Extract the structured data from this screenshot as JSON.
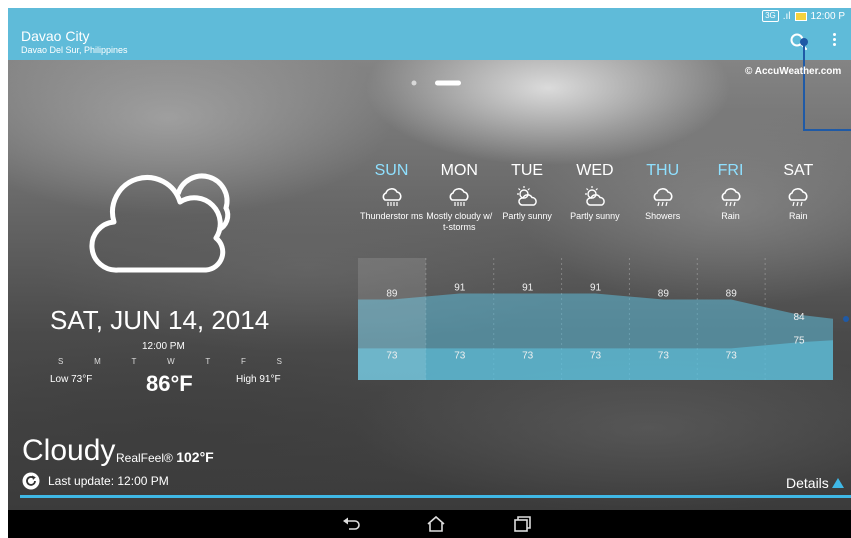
{
  "status_bar": {
    "network": "3G",
    "signal": ".ıl",
    "time": "12:00 P"
  },
  "app_bar": {
    "city": "Davao City",
    "region": "Davao Del Sur, Philippines",
    "search_icon": "search-icon",
    "menu_icon": "more-vert-icon"
  },
  "attribution": "© AccuWeather.com",
  "today": {
    "date": "SAT, JUN 14, 2014",
    "time": "12:00 PM",
    "days": [
      "S",
      "M",
      "T",
      "W",
      "T",
      "F",
      "S"
    ],
    "low": "Low 73°F",
    "current": "86°F",
    "high": "High 91°F",
    "condition": "Cloudy",
    "realfeel_label": "RealFeel®",
    "realfeel_value": "102°F",
    "last_update": "Last update: 12:00 PM"
  },
  "forecast": [
    {
      "day": "SUN",
      "cond": "Thunderstor ms",
      "icon": "thunderstorm-icon",
      "accent": true
    },
    {
      "day": "MON",
      "cond": "Mostly cloudy w/ t-storms",
      "icon": "thunderstorm-icon",
      "accent": false
    },
    {
      "day": "TUE",
      "cond": "Partly sunny",
      "icon": "partly-sunny-icon",
      "accent": false
    },
    {
      "day": "WED",
      "cond": "Partly sunny",
      "icon": "partly-sunny-icon",
      "accent": false
    },
    {
      "day": "THU",
      "cond": "Showers",
      "icon": "showers-icon",
      "accent": true
    },
    {
      "day": "FRI",
      "cond": "Rain",
      "icon": "rain-icon",
      "accent": true
    },
    {
      "day": "SAT",
      "cond": "Rain",
      "icon": "rain-icon",
      "accent": false
    }
  ],
  "chart_data": {
    "type": "area",
    "categories": [
      "SUN",
      "MON",
      "TUE",
      "WED",
      "THU",
      "FRI",
      "SAT"
    ],
    "series": [
      {
        "values": [
          89,
          91,
          91,
          91,
          89,
          89,
          84
        ]
      },
      {
        "values": [
          73,
          73,
          73,
          73,
          73,
          73,
          75
        ]
      }
    ],
    "colors": {
      "accent": "#5fbbd9",
      "day_active": "#8fe0ff"
    }
  },
  "details": "Details",
  "colors": {
    "bar": "#5fbbd9",
    "progress": "#3fb8e6",
    "callout": "#1f5aa6"
  }
}
